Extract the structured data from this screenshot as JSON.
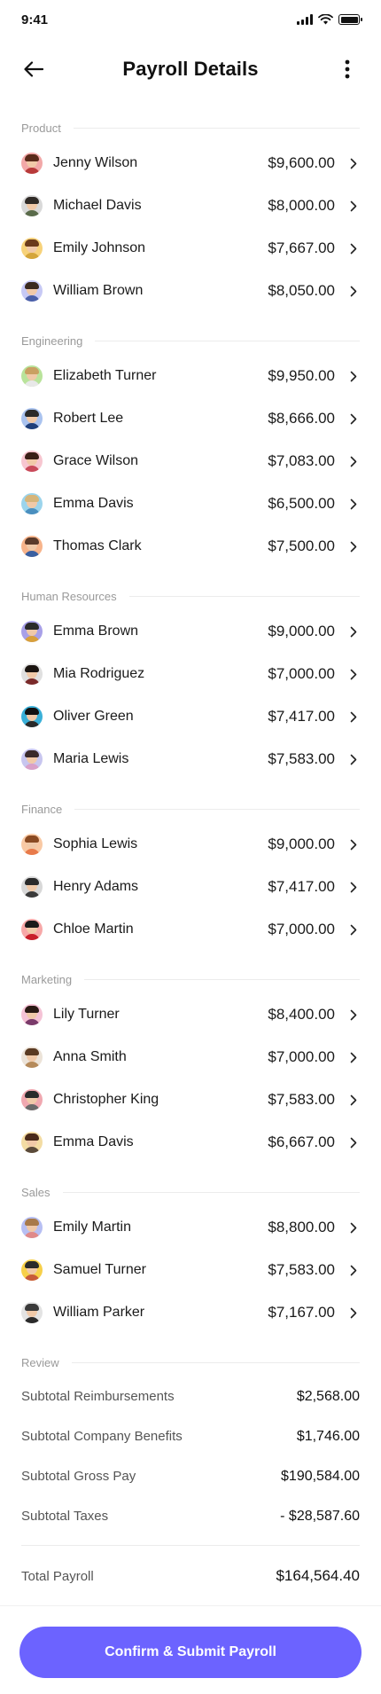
{
  "status": {
    "time": "9:41"
  },
  "header": {
    "title": "Payroll Details"
  },
  "sections": [
    {
      "label": "Product",
      "employees": [
        {
          "name": "Jenny Wilson",
          "amount": "$9,600.00",
          "bg": "#f2a8a8",
          "hair": "#5a2a1a",
          "shirt": "#b83a3a"
        },
        {
          "name": "Michael Davis",
          "amount": "$8,000.00",
          "bg": "#d9d9d9",
          "hair": "#2f2a26",
          "shirt": "#5a6b4a"
        },
        {
          "name": "Emily Johnson",
          "amount": "$7,667.00",
          "bg": "#f7d27a",
          "hair": "#6b3b1b",
          "shirt": "#d4a53a"
        },
        {
          "name": "William Brown",
          "amount": "$8,050.00",
          "bg": "#c7c9f5",
          "hair": "#3b2a20",
          "shirt": "#4a5fa8"
        }
      ]
    },
    {
      "label": "Engineering",
      "employees": [
        {
          "name": "Elizabeth Turner",
          "amount": "$9,950.00",
          "bg": "#b9e39b",
          "hair": "#c9a062",
          "shirt": "#e8e8e8"
        },
        {
          "name": "Robert Lee",
          "amount": "$8,666.00",
          "bg": "#aac3ef",
          "hair": "#2a2a2a",
          "shirt": "#1f3f7a"
        },
        {
          "name": "Grace Wilson",
          "amount": "$7,083.00",
          "bg": "#f7c6d0",
          "hair": "#3a1f17",
          "shirt": "#c94a5a"
        },
        {
          "name": "Emma Davis",
          "amount": "$6,500.00",
          "bg": "#9bd4ec",
          "hair": "#d6b57a",
          "shirt": "#4a8fbf"
        },
        {
          "name": "Thomas Clark",
          "amount": "$7,500.00",
          "bg": "#f7b48b",
          "hair": "#5a3a2a",
          "shirt": "#3a5fa0"
        }
      ]
    },
    {
      "label": "Human Resources",
      "employees": [
        {
          "name": "Emma Brown",
          "amount": "$9,000.00",
          "bg": "#a8a0e8",
          "hair": "#2a2a2a",
          "shirt": "#d9a03a"
        },
        {
          "name": "Mia Rodriguez",
          "amount": "$7,000.00",
          "bg": "#e0e0e0",
          "hair": "#1a1410",
          "shirt": "#7a2a2a"
        },
        {
          "name": "Oliver Green",
          "amount": "$7,417.00",
          "bg": "#3ab0d8",
          "hair": "#111111",
          "shirt": "#2a2a2a"
        },
        {
          "name": "Maria Lewis",
          "amount": "$7,583.00",
          "bg": "#c8c6ef",
          "hair": "#3a2a2a",
          "shirt": "#d9a0c8"
        }
      ]
    },
    {
      "label": "Finance",
      "employees": [
        {
          "name": "Sophia Lewis",
          "amount": "$9,000.00",
          "bg": "#f9c9a4",
          "hair": "#8a4a22",
          "shirt": "#e87a4a"
        },
        {
          "name": "Henry Adams",
          "amount": "$7,417.00",
          "bg": "#d8d8d8",
          "hair": "#2a2a2a",
          "shirt": "#3a3a3a"
        },
        {
          "name": "Chloe Martin",
          "amount": "$7,000.00",
          "bg": "#f7a8a8",
          "hair": "#1a1a1a",
          "shirt": "#c81e2a"
        }
      ]
    },
    {
      "label": "Marketing",
      "employees": [
        {
          "name": "Lily Turner",
          "amount": "$8,400.00",
          "bg": "#f5c3d6",
          "hair": "#2a1a14",
          "shirt": "#7a3a6a"
        },
        {
          "name": "Anna Smith",
          "amount": "$7,000.00",
          "bg": "#ece3d8",
          "hair": "#5a3a22",
          "shirt": "#b58a5a"
        },
        {
          "name": "Christopher King",
          "amount": "$7,583.00",
          "bg": "#f0a8b0",
          "hair": "#2a2a2a",
          "shirt": "#6a6a6a"
        },
        {
          "name": "Emma Davis",
          "amount": "$6,667.00",
          "bg": "#f3dca3",
          "hair": "#4a2a1a",
          "shirt": "#5a4a3a"
        }
      ]
    },
    {
      "label": "Sales",
      "employees": [
        {
          "name": "Emily Martin",
          "amount": "$8,800.00",
          "bg": "#b7bff3",
          "hair": "#a87a4a",
          "shirt": "#e08a8a"
        },
        {
          "name": "Samuel Turner",
          "amount": "$7,583.00",
          "bg": "#f7d04a",
          "hair": "#2a2a2a",
          "shirt": "#c85a3a"
        },
        {
          "name": "William Parker",
          "amount": "$7,167.00",
          "bg": "#e3e3e3",
          "hair": "#3a3a3a",
          "shirt": "#2a2a2a"
        }
      ]
    }
  ],
  "review": {
    "label": "Review",
    "items": [
      {
        "label": "Subtotal Reimbursements",
        "value": "$2,568.00"
      },
      {
        "label": "Subtotal Company Benefits",
        "value": "$1,746.00"
      },
      {
        "label": "Subtotal Gross Pay",
        "value": "$190,584.00"
      },
      {
        "label": "Subtotal Taxes",
        "value": "- $28,587.60"
      }
    ],
    "total_label": "Total Payroll",
    "total_value": "$164,564.40"
  },
  "footer": {
    "submit_label": "Confirm & Submit Payroll"
  },
  "colors": {
    "accent": "#6c63ff",
    "muted": "#9a9a9a",
    "rule": "#ececec"
  },
  "icons": {
    "back": "arrow-left-icon",
    "more": "more-vertical-icon",
    "row": "chevron-right-icon"
  }
}
